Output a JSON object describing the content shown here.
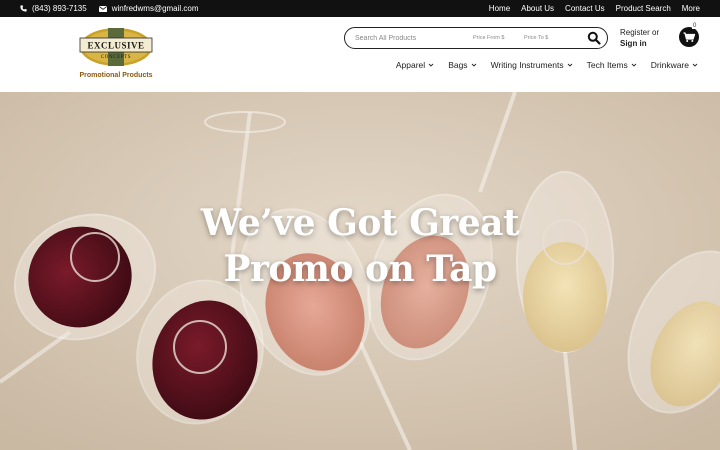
{
  "topbar": {
    "phone": "(843) 893-7135",
    "email": "winfredwms@gmail.com",
    "links": [
      "Home",
      "About Us",
      "Contact Us",
      "Product Search",
      "More"
    ]
  },
  "logo": {
    "line1": "EXCLUSIVE",
    "line2": "CONCEPTS",
    "tagline": "Promotional Products"
  },
  "search": {
    "placeholder": "Search All Products",
    "price_from_placeholder": "Price From $",
    "price_to_placeholder": "Price To $"
  },
  "account": {
    "register": "Register or",
    "signin": "Sign in"
  },
  "cart": {
    "count": "0"
  },
  "nav": [
    "Apparel",
    "Bags",
    "Writing Instruments",
    "Tech Items",
    "Drinkware"
  ],
  "hero": {
    "line1": "We’ve Got Great",
    "line2": "Promo on Tap"
  },
  "colors": {
    "topbar_bg": "#111111",
    "logo_gold": "#c9a227",
    "logo_brown": "#8a5a10",
    "hero_bg": "#d8cbb9"
  },
  "icons": [
    "phone-icon",
    "envelope-icon",
    "search-icon",
    "cart-icon",
    "chevron-down-icon"
  ]
}
